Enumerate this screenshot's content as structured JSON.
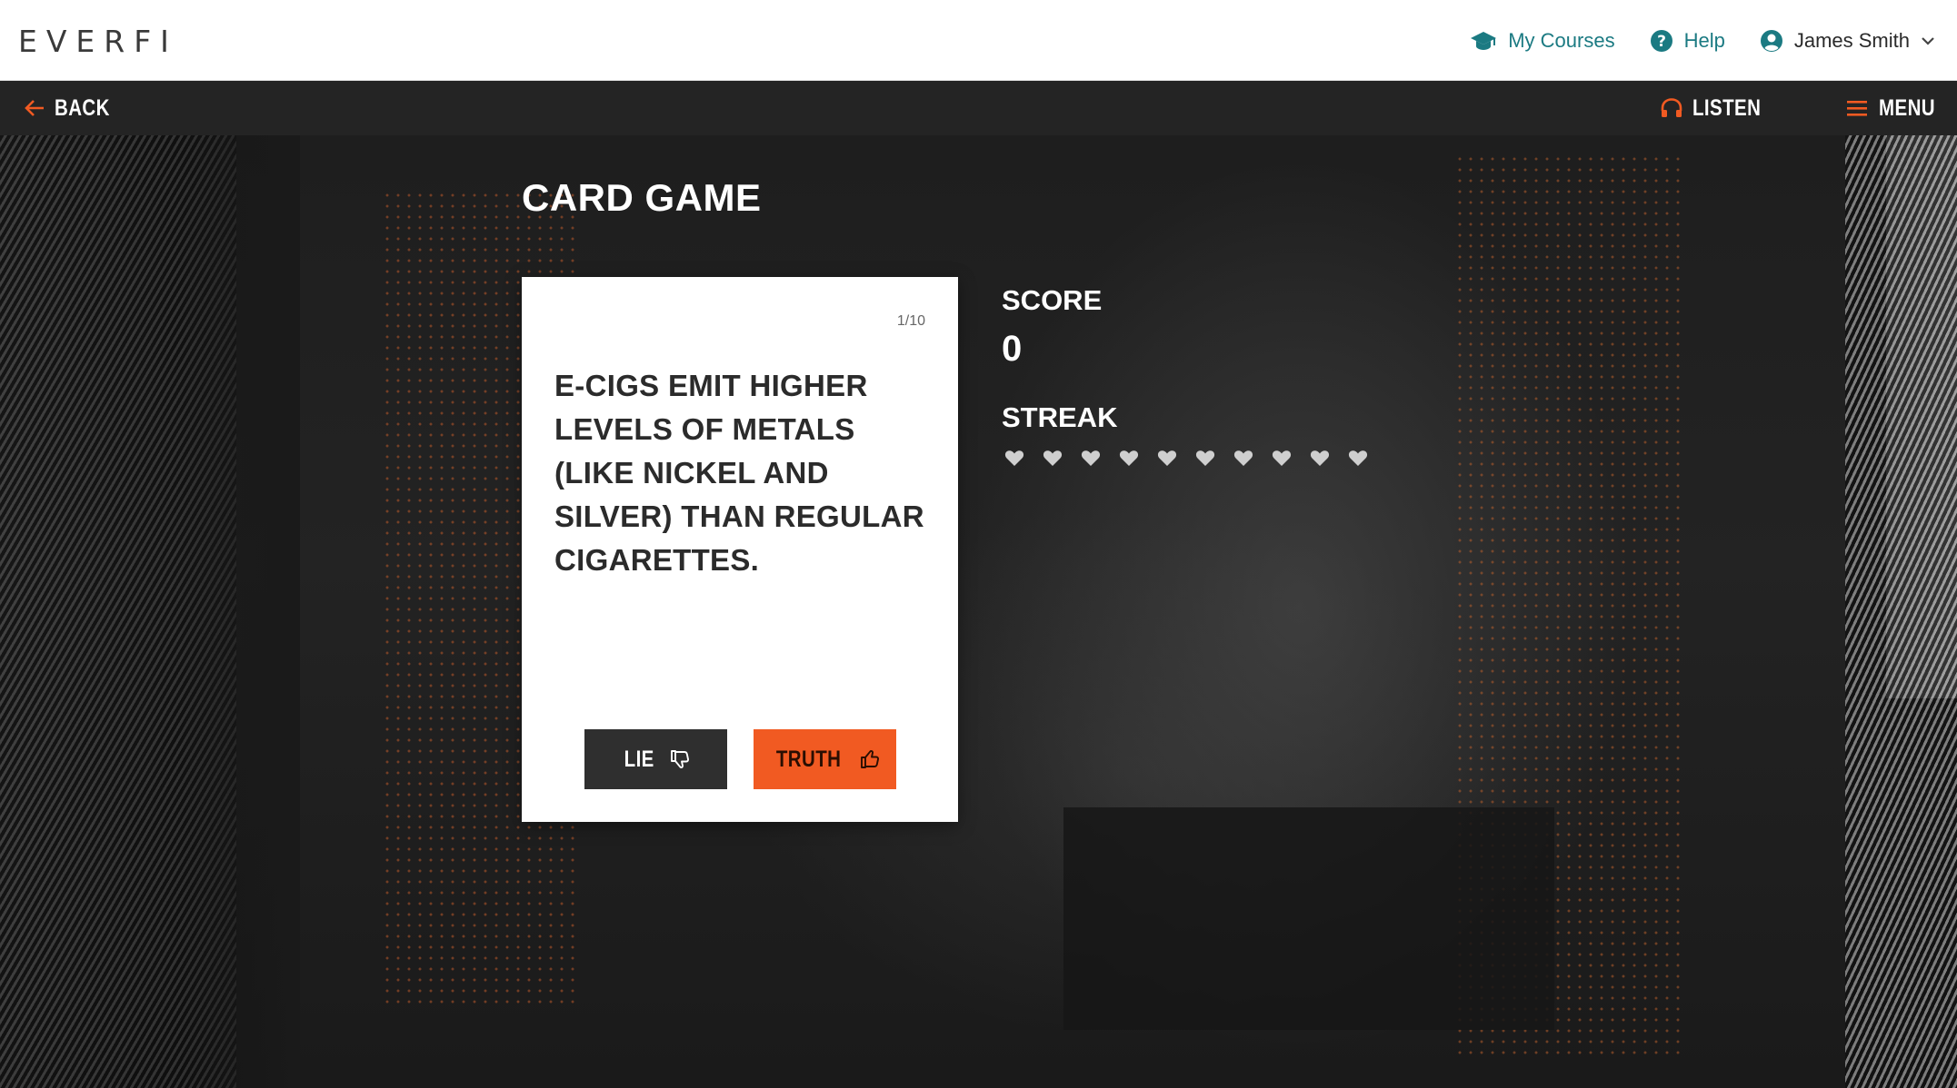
{
  "header": {
    "logo": "EVERFI",
    "nav": {
      "my_courses": "My Courses",
      "help": "Help",
      "user_name": "James Smith"
    }
  },
  "toolbar": {
    "back_label": "BACK",
    "listen_label": "LISTEN",
    "menu_label": "MENU"
  },
  "page": {
    "title": "CARD GAME"
  },
  "card": {
    "counter": "1/10",
    "question": "E-CIGS EMIT HIGHER LEVELS OF METALS (LIKE NICKEL AND SILVER) THAN REGULAR CIGARETTES.",
    "lie_label": "LIE",
    "truth_label": "TRUTH"
  },
  "stats": {
    "score_label": "SCORE",
    "score_value": "0",
    "streak_label": "STREAK",
    "streak_total": 10,
    "streak_filled": 0
  },
  "colors": {
    "accent": "#f15a22",
    "teal": "#1b7a82",
    "dark_bar": "#242424",
    "heart": "#cfcfcf"
  },
  "icons": {
    "my_courses": "graduation-cap-icon",
    "help": "help-circle-icon",
    "user": "user-circle-icon",
    "dropdown": "chevron-down-icon",
    "back": "arrow-left-icon",
    "listen": "headphones-icon",
    "menu": "hamburger-icon",
    "lie": "thumbs-down-icon",
    "truth": "thumbs-up-icon",
    "streak": "heart-icon"
  }
}
